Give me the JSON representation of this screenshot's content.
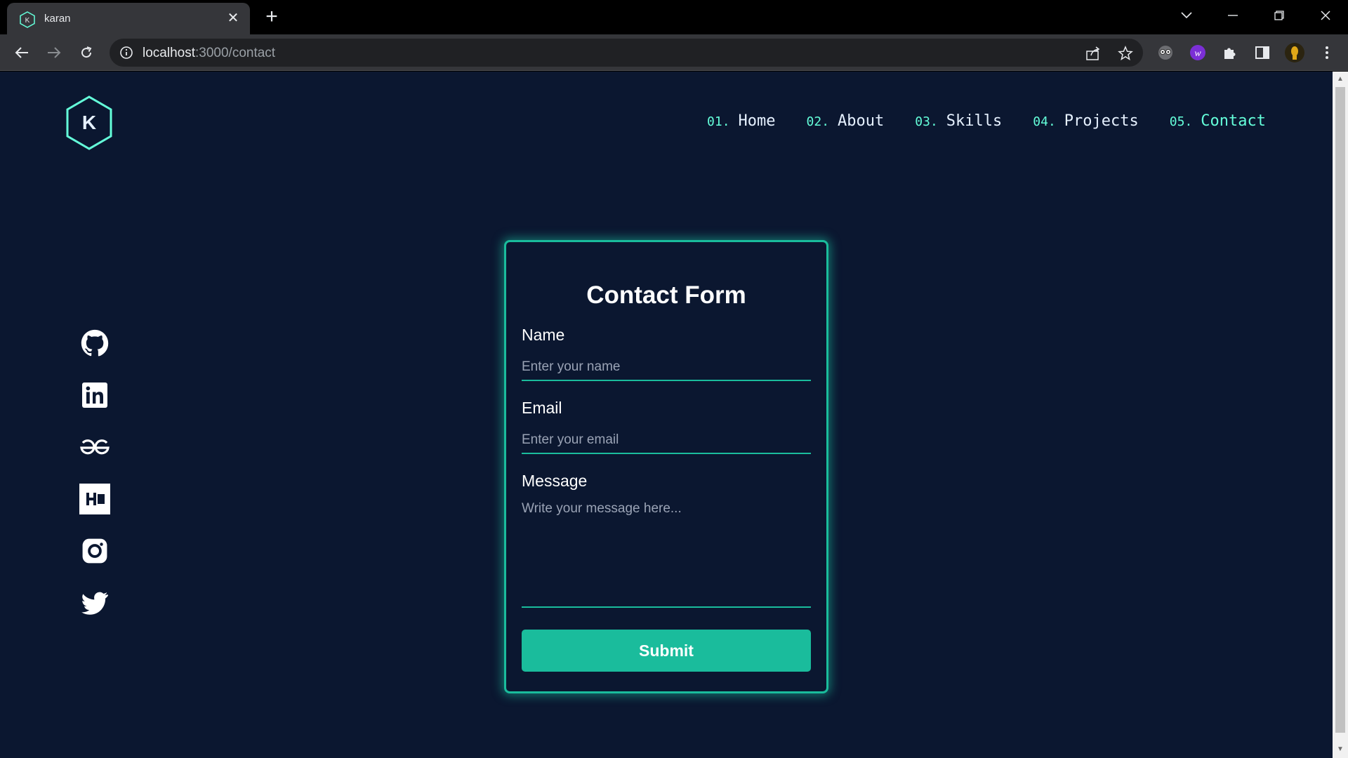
{
  "browser": {
    "tab_title": "karan",
    "tab_close_glyph": "✕",
    "new_tab_glyph": "+",
    "url_host": "localhost",
    "url_path": ":3000/contact"
  },
  "site": {
    "logo_letter": "K",
    "accent_color": "#64ffda",
    "background_color": "#0b1730"
  },
  "nav": [
    {
      "num": "01.",
      "label": "Home"
    },
    {
      "num": "02.",
      "label": "About"
    },
    {
      "num": "03.",
      "label": "Skills"
    },
    {
      "num": "04.",
      "label": "Projects"
    },
    {
      "num": "05.",
      "label": "Contact"
    }
  ],
  "socials": [
    "github-icon",
    "linkedin-icon",
    "geeksforgeeks-icon",
    "hashnode-icon",
    "instagram-icon",
    "twitter-icon"
  ],
  "form": {
    "title": "Contact Form",
    "name_label": "Name",
    "name_placeholder": "Enter your name",
    "email_label": "Email",
    "email_placeholder": "Enter your email",
    "message_label": "Message",
    "message_placeholder": "Write your message here...",
    "submit_label": "Submit",
    "button_color": "#1abc9c"
  }
}
